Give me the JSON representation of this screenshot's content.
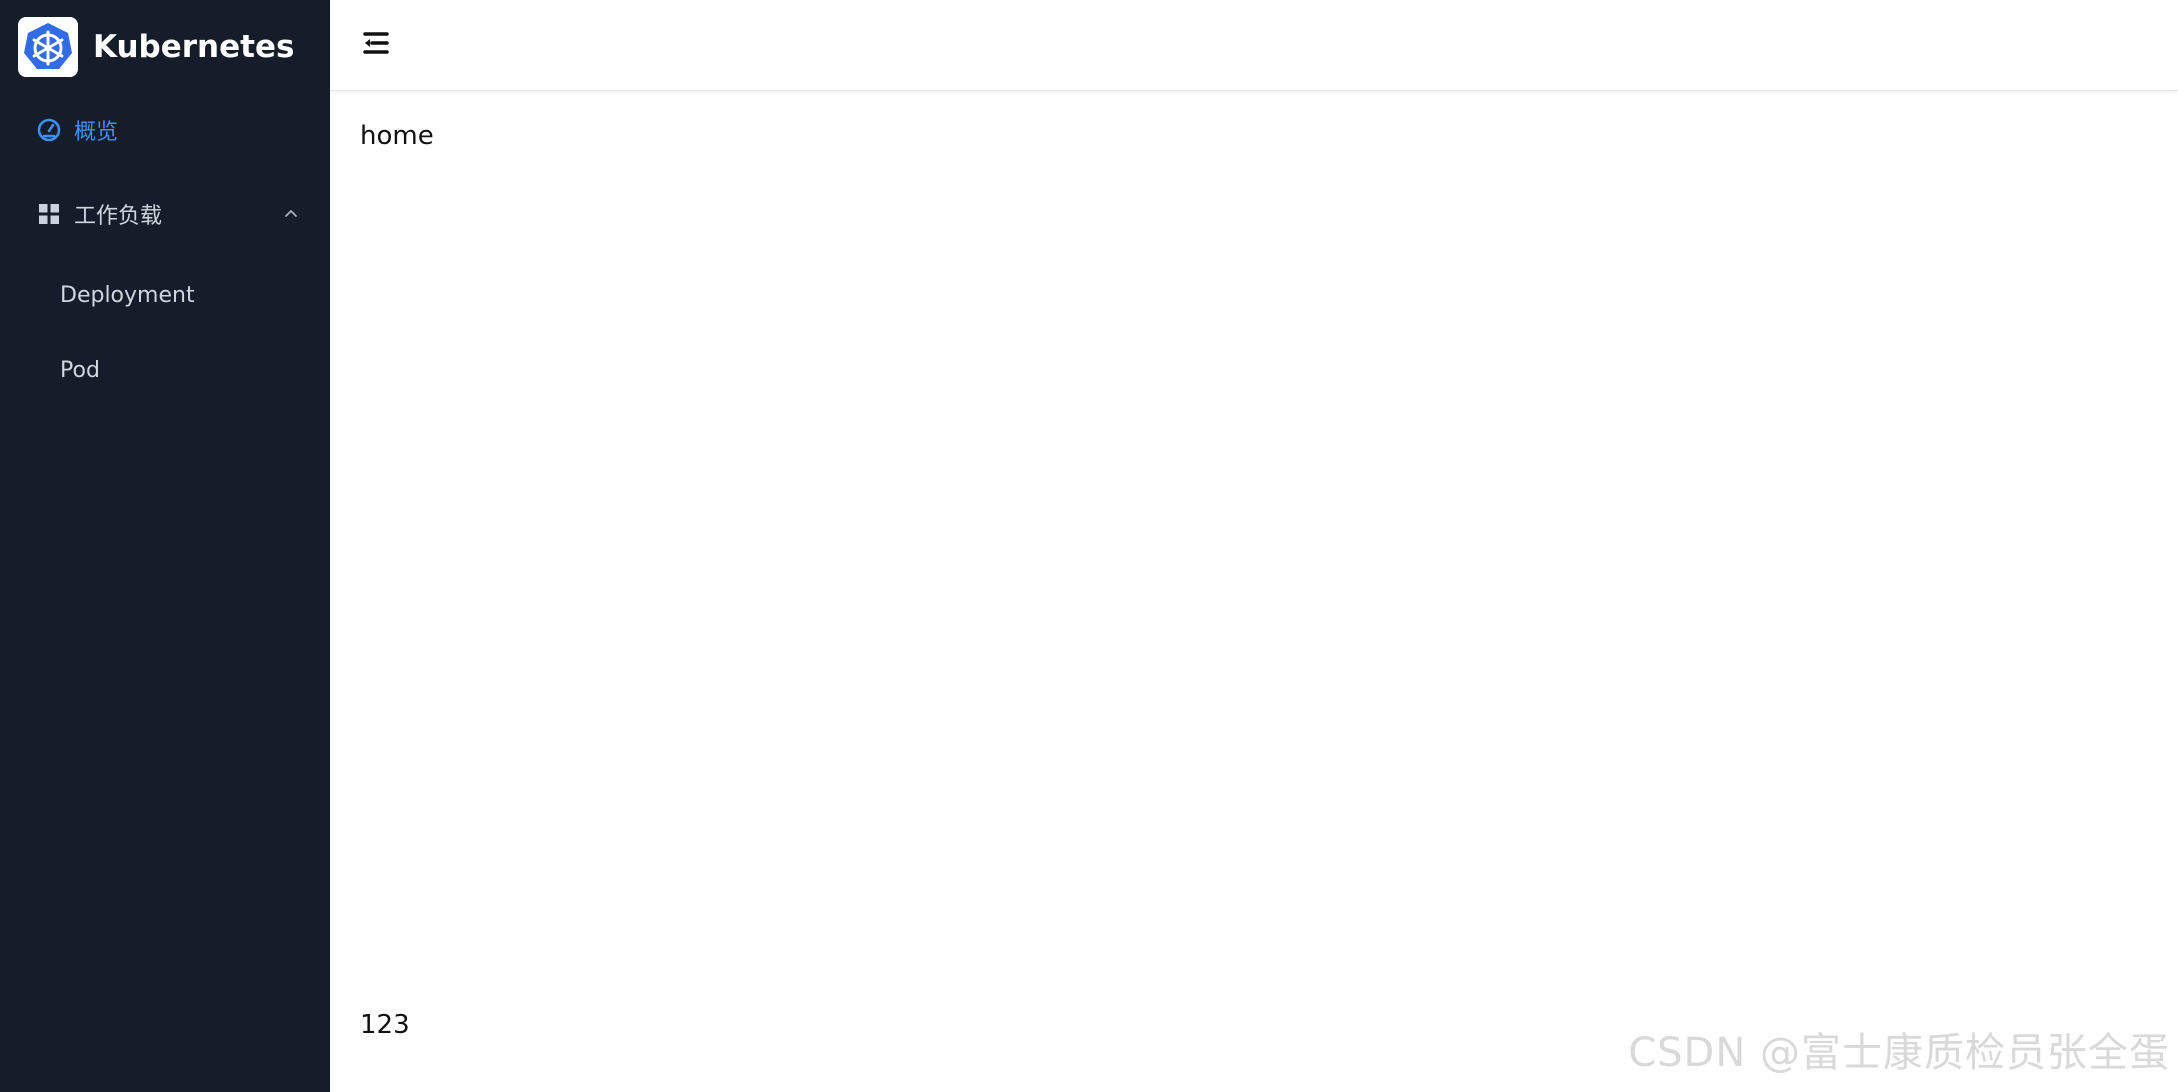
{
  "app": {
    "title": "Kubernetes",
    "logo_icon": "kubernetes-helm-icon",
    "brand_color": "#326ce5"
  },
  "sidebar": {
    "background": "#141d29",
    "items": [
      {
        "label": "概览",
        "icon": "dashboard-gauge-icon",
        "active": true
      },
      {
        "label": "工作负载",
        "icon": "grid-icon",
        "expanded": true,
        "children": [
          {
            "label": "Deployment"
          },
          {
            "label": "Pod"
          }
        ]
      }
    ],
    "active_color": "#3e8ff7"
  },
  "header": {
    "collapse_icon": "menu-collapse-icon"
  },
  "main": {
    "content_text": "home",
    "footer_text": "123"
  },
  "watermark": {
    "text": "CSDN @富士康质检员张全蛋"
  }
}
